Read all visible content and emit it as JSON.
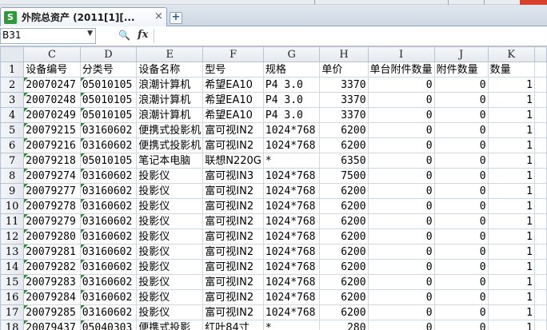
{
  "tab": {
    "title": "外院总资产 (2011[1][...",
    "close_icon": "×",
    "add_icon": "+"
  },
  "formula_bar": {
    "name_box": "B31",
    "fx": "fx"
  },
  "columns": [
    "C",
    "D",
    "E",
    "F",
    "G",
    "H",
    "I",
    "J",
    "K"
  ],
  "rows": [
    {
      "n": "1",
      "c": "设备编号",
      "d": "分类号",
      "e": "设备名称",
      "f": "型号",
      "g": "规格",
      "h": "单价",
      "i": "单台附件数量",
      "j": "附件数量",
      "k": "数量"
    },
    {
      "n": "2",
      "c": "20070247",
      "d": "05010105",
      "e": "浪潮计算机",
      "f": "希望EA10",
      "g": "P4 3.0",
      "h": "3370",
      "i": "0",
      "j": "0",
      "k": "1"
    },
    {
      "n": "3",
      "c": "20070248",
      "d": "05010105",
      "e": "浪潮计算机",
      "f": "希望EA10",
      "g": "P4 3.0",
      "h": "3370",
      "i": "0",
      "j": "0",
      "k": "1"
    },
    {
      "n": "4",
      "c": "20070249",
      "d": "05010105",
      "e": "浪潮计算机",
      "f": "希望EA10",
      "g": "P4 3.0",
      "h": "3370",
      "i": "0",
      "j": "0",
      "k": "1"
    },
    {
      "n": "5",
      "c": "20079215",
      "d": "03160602",
      "e": "便携式投影机",
      "f": "富可视IN2",
      "g": "1024*768",
      "h": "6200",
      "i": "0",
      "j": "0",
      "k": "1"
    },
    {
      "n": "6",
      "c": "20079216",
      "d": "03160602",
      "e": "便携式投影机",
      "f": "富可视IN2",
      "g": "1024*768",
      "h": "6200",
      "i": "0",
      "j": "0",
      "k": "1"
    },
    {
      "n": "7",
      "c": "20079218",
      "d": "05010105",
      "e": "笔记本电脑",
      "f": "联想N220G",
      "g": "*",
      "h": "6350",
      "i": "0",
      "j": "0",
      "k": "1"
    },
    {
      "n": "8",
      "c": "20079274",
      "d": "03160602",
      "e": "投影仪",
      "f": "富可视IN3",
      "g": "1024*768",
      "h": "7500",
      "i": "0",
      "j": "0",
      "k": "1"
    },
    {
      "n": "9",
      "c": "20079277",
      "d": "03160602",
      "e": "投影仪",
      "f": "富可视IN2",
      "g": "1024*768",
      "h": "6200",
      "i": "0",
      "j": "0",
      "k": "1"
    },
    {
      "n": "10",
      "c": "20079278",
      "d": "03160602",
      "e": "投影仪",
      "f": "富可视IN2",
      "g": "1024*768",
      "h": "6200",
      "i": "0",
      "j": "0",
      "k": "1"
    },
    {
      "n": "11",
      "c": "20079279",
      "d": "03160602",
      "e": "投影仪",
      "f": "富可视IN2",
      "g": "1024*768",
      "h": "6200",
      "i": "0",
      "j": "0",
      "k": "1"
    },
    {
      "n": "12",
      "c": "20079280",
      "d": "03160602",
      "e": "投影仪",
      "f": "富可视IN2",
      "g": "1024*768",
      "h": "6200",
      "i": "0",
      "j": "0",
      "k": "1"
    },
    {
      "n": "13",
      "c": "20079281",
      "d": "03160602",
      "e": "投影仪",
      "f": "富可视IN2",
      "g": "1024*768",
      "h": "6200",
      "i": "0",
      "j": "0",
      "k": "1"
    },
    {
      "n": "14",
      "c": "20079282",
      "d": "03160602",
      "e": "投影仪",
      "f": "富可视IN2",
      "g": "1024*768",
      "h": "6200",
      "i": "0",
      "j": "0",
      "k": "1"
    },
    {
      "n": "15",
      "c": "20079283",
      "d": "03160602",
      "e": "投影仪",
      "f": "富可视IN2",
      "g": "1024*768",
      "h": "6200",
      "i": "0",
      "j": "0",
      "k": "1"
    },
    {
      "n": "16",
      "c": "20079284",
      "d": "03160602",
      "e": "投影仪",
      "f": "富可视IN2",
      "g": "1024*768",
      "h": "6200",
      "i": "0",
      "j": "0",
      "k": "1"
    },
    {
      "n": "17",
      "c": "20079285",
      "d": "03160602",
      "e": "投影仪",
      "f": "富可视IN2",
      "g": "1024*768",
      "h": "6200",
      "i": "0",
      "j": "0",
      "k": "1"
    },
    {
      "n": "18",
      "c": "20079437",
      "d": "05040303",
      "e": "便携式投影",
      "f": "红叶84寸",
      "g": "*",
      "h": "280",
      "i": "0",
      "j": "0",
      "k": "1"
    }
  ],
  "colors": {
    "tab_icon": "#2f9a3a",
    "error_triangle": "#2e8b3a",
    "header_bg": "#e4e9ef"
  }
}
